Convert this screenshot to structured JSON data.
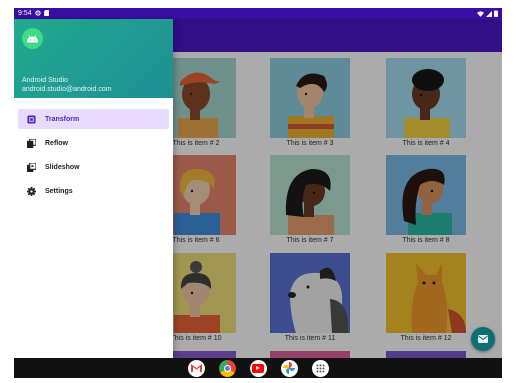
{
  "status_bar": {
    "time": "9:54"
  },
  "drawer": {
    "user_name": "Android Studio",
    "user_email": "android.studio@android.com",
    "items": [
      {
        "label": "Transform",
        "icon": "transform-icon",
        "active": true
      },
      {
        "label": "Reflow",
        "icon": "reflow-icon",
        "active": false
      },
      {
        "label": "Slideshow",
        "icon": "slideshow-icon",
        "active": false
      },
      {
        "label": "Settings",
        "icon": "settings-gear-icon",
        "active": false
      }
    ]
  },
  "grid": {
    "items": [
      {
        "caption": "This is item # 2"
      },
      {
        "caption": "This is item # 3"
      },
      {
        "caption": "This is item # 4"
      },
      {
        "caption": "This is item # 6"
      },
      {
        "caption": "This is item # 7"
      },
      {
        "caption": "This is item # 8"
      },
      {
        "caption": "This is item # 10"
      },
      {
        "caption": "This is item # 11"
      },
      {
        "caption": "This is item # 12"
      }
    ]
  },
  "nav_bar": {
    "apps": [
      "gmail-icon",
      "chrome-icon",
      "youtube-icon",
      "photos-icon",
      "app-drawer-icon"
    ]
  },
  "colors": {
    "status_bar": "#3b0ea3",
    "app_bar": "#4a17c9",
    "drawer_header": "#1d8f94",
    "active_item_bg": "#e7dcff",
    "fab": "#0d6f73"
  }
}
